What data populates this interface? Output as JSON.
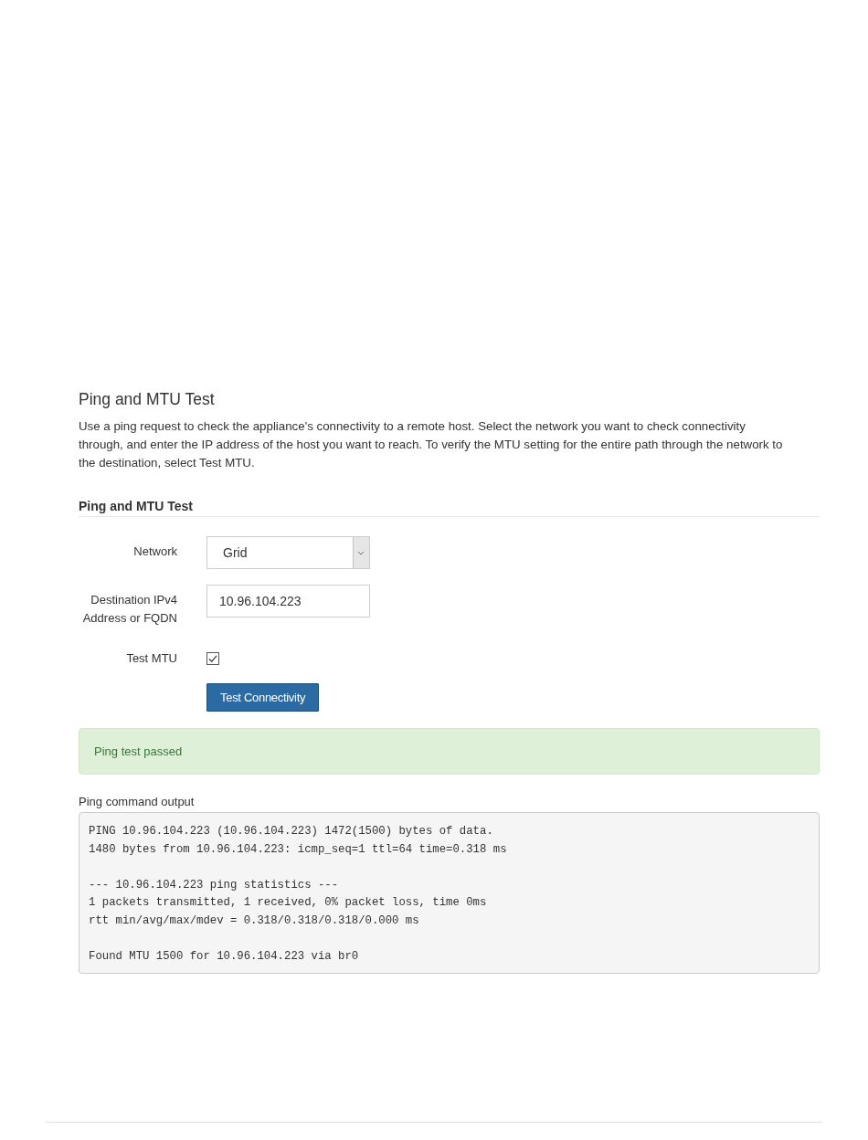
{
  "page": {
    "title": "Ping and MTU Test",
    "description": "Use a ping request to check the appliance's connectivity to a remote host. Select the network you want to check connectivity through, and enter the IP address of the host you want to reach. To verify the MTU setting for the entire path through the network to the destination, select Test MTU."
  },
  "form": {
    "title": "Ping and MTU Test",
    "fields": [
      {
        "kind": "select",
        "label": "Network",
        "value": "Grid"
      },
      {
        "kind": "text",
        "label": "Destination IPv4 Address or FQDN",
        "value": "10.96.104.223"
      },
      {
        "kind": "checkbox",
        "label": "Test MTU",
        "checked": true
      }
    ],
    "button": "Test Connectivity"
  },
  "alert": {
    "kind": "success",
    "message": "Ping test passed"
  },
  "output": {
    "label": "Ping command output",
    "blocks": [
      [
        "PING 10.96.104.223 (10.96.104.223) 1472(1500) bytes of data.",
        "1480 bytes from 10.96.104.223: icmp_seq=1 ttl=64 time=0.318 ms"
      ],
      [
        "--- 10.96.104.223 ping statistics ---",
        "1 packets transmitted, 1 received, 0% packet loss, time 0ms",
        "rtt min/avg/max/mdev = 0.318/0.318/0.318/0.000 ms"
      ],
      [
        "Found MTU 1500 for 10.96.104.223 via br0"
      ]
    ]
  }
}
